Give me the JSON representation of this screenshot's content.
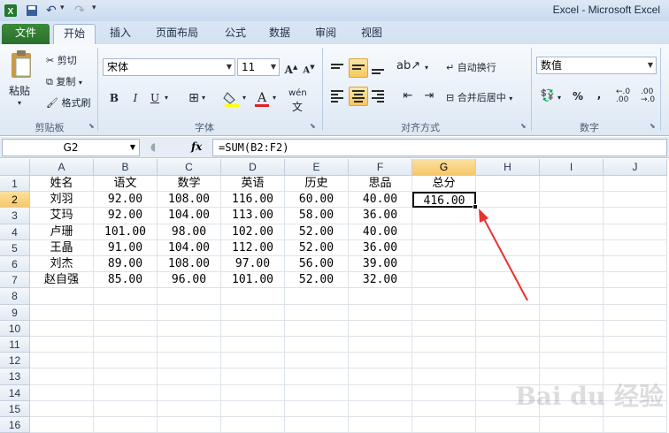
{
  "window": {
    "title": "Excel  -  Microsoft Excel"
  },
  "tabs": [
    "文件",
    "开始",
    "插入",
    "页面布局",
    "公式",
    "数据",
    "审阅",
    "视图"
  ],
  "ribbon": {
    "clipboard": {
      "paste": "粘贴",
      "cut": "剪切",
      "copy": "复制",
      "format_painter": "格式刷",
      "label": "剪贴板"
    },
    "font": {
      "name": "宋体",
      "size": "11",
      "grow": "A",
      "shrink": "A",
      "bold": "B",
      "italic": "I",
      "underline": "U",
      "phonetic": "wén",
      "label": "字体"
    },
    "alignment": {
      "wrap": "自动换行",
      "merge": "合并后居中",
      "label": "对齐方式"
    },
    "number": {
      "format": "数值",
      "percent": "%",
      "comma": ",",
      "inc_decimal": ".00",
      "dec_decimal": ".00",
      "label": "数字"
    }
  },
  "formula_bar": {
    "name_box": "G2",
    "fx": "fx",
    "formula": "=SUM(B2:F2)"
  },
  "columns": [
    "A",
    "B",
    "C",
    "D",
    "E",
    "F",
    "G",
    "H",
    "I",
    "J"
  ],
  "rows": [
    "1",
    "2",
    "3",
    "4",
    "5",
    "6",
    "7",
    "8",
    "9",
    "10",
    "11",
    "12",
    "13",
    "14",
    "15",
    "16"
  ],
  "sheet": {
    "header": [
      "姓名",
      "语文",
      "数学",
      "英语",
      "历史",
      "思品",
      "总分"
    ],
    "data": [
      [
        "刘羽",
        "92.00",
        "108.00",
        "116.00",
        "60.00",
        "40.00",
        "416.00"
      ],
      [
        "艾玛",
        "92.00",
        "104.00",
        "113.00",
        "58.00",
        "36.00",
        ""
      ],
      [
        "卢珊",
        "101.00",
        "98.00",
        "102.00",
        "52.00",
        "40.00",
        ""
      ],
      [
        "王晶",
        "91.00",
        "104.00",
        "112.00",
        "52.00",
        "36.00",
        ""
      ],
      [
        "刘杰",
        "89.00",
        "108.00",
        "97.00",
        "56.00",
        "39.00",
        ""
      ],
      [
        "赵自强",
        "85.00",
        "96.00",
        "101.00",
        "52.00",
        "32.00",
        ""
      ]
    ]
  },
  "watermark": "Bai du 经验",
  "colors": {
    "accent_file_tab": "#2a6f2a",
    "selection": "#f7c86a",
    "arrow": "#e8322f"
  }
}
